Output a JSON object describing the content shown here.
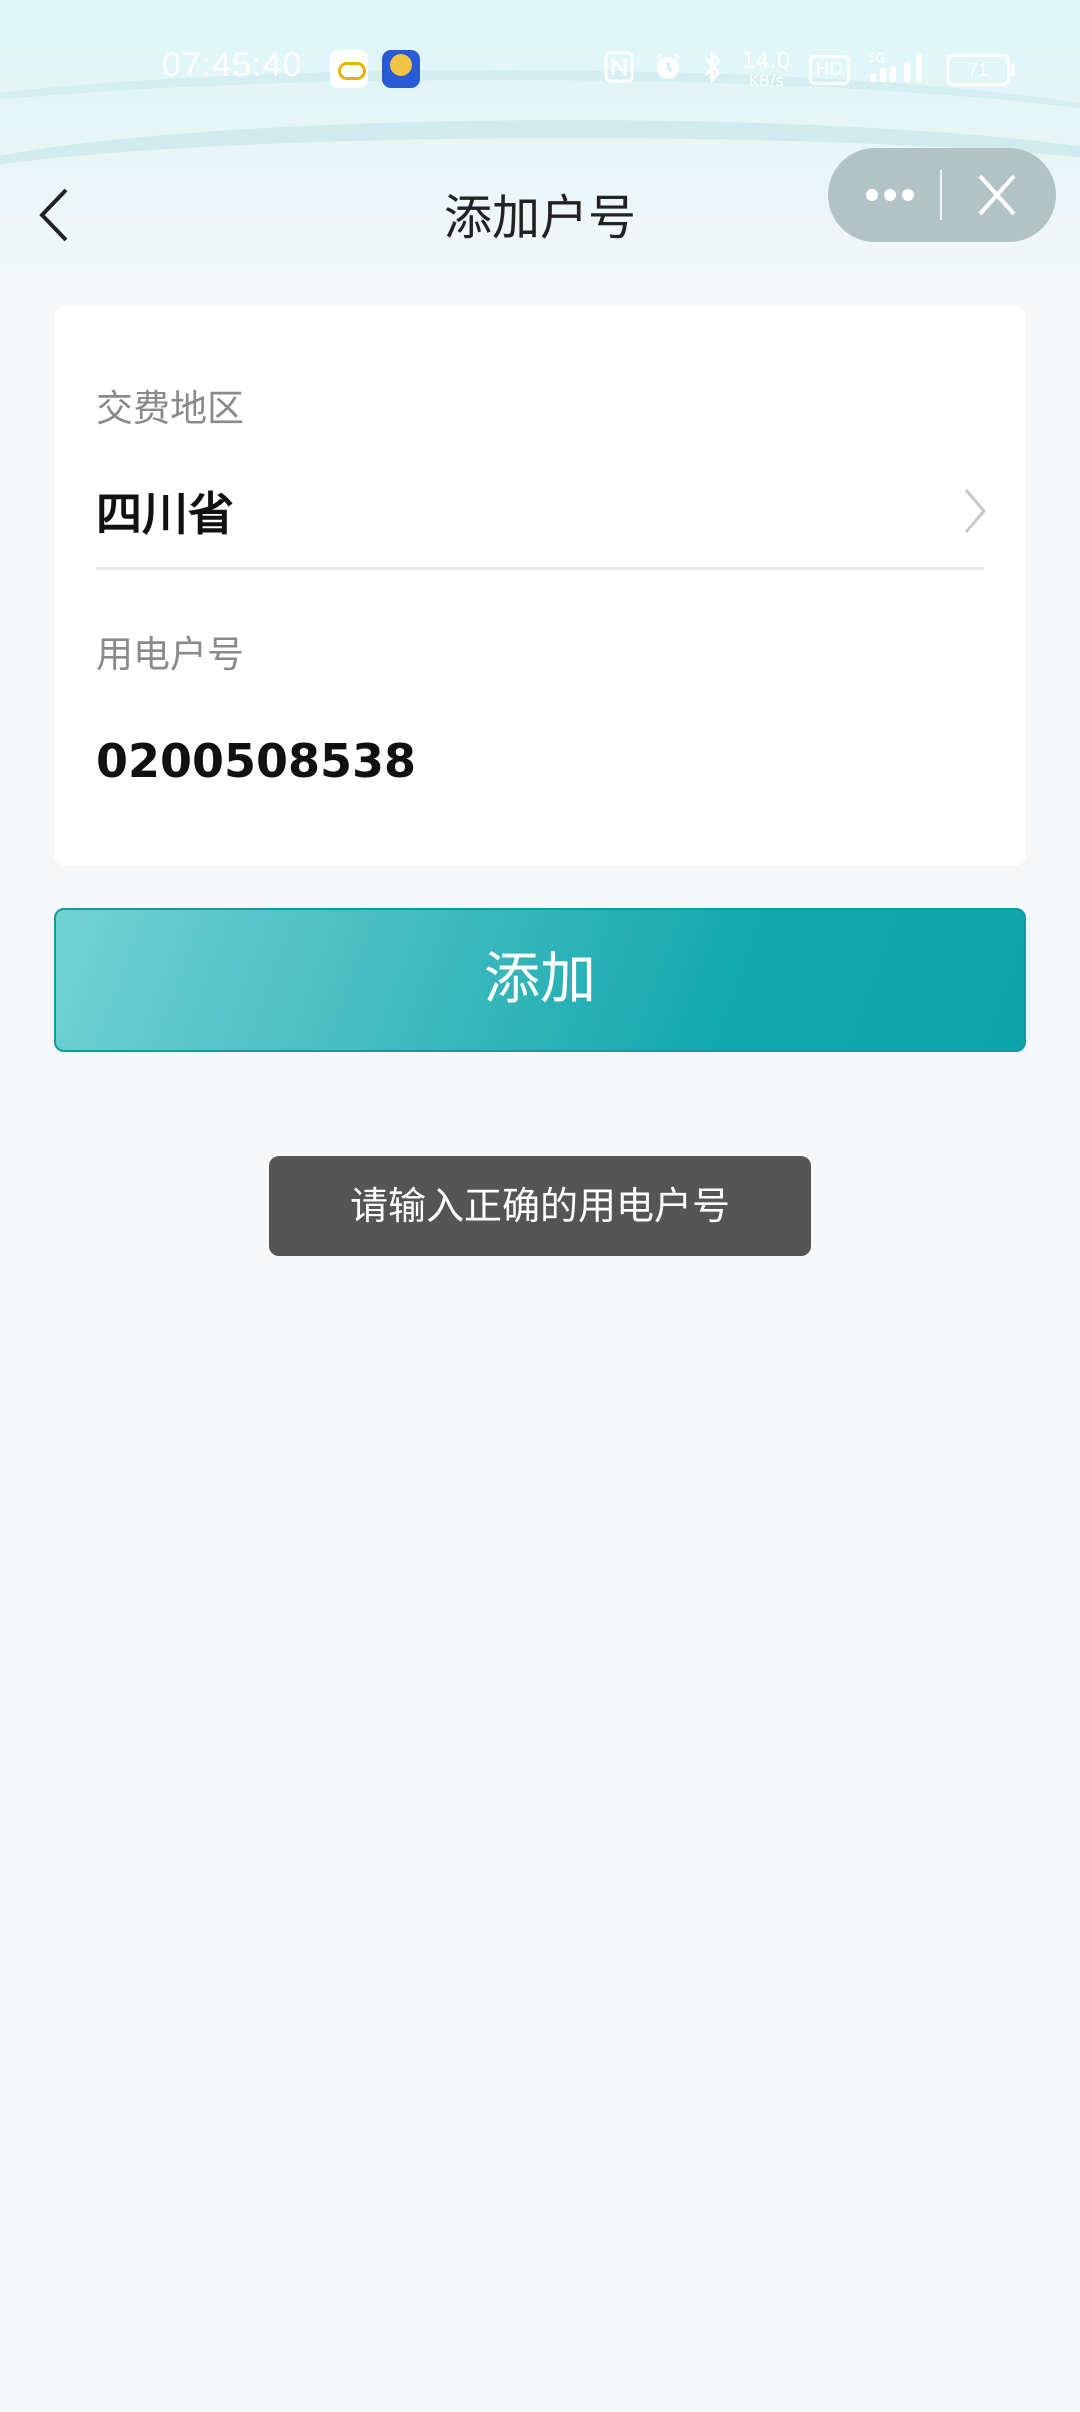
{
  "status_bar": {
    "time": "07:45:40",
    "net_speed_value": "14.0",
    "net_speed_unit": "KB/s",
    "network_type": "HD",
    "signal": "5G",
    "battery": "71",
    "icons": [
      "weather-app-icon",
      "mascot-app-icon",
      "nfc-icon",
      "alarm-icon",
      "bluetooth-icon",
      "hd-icon",
      "signal-icon",
      "battery-icon"
    ]
  },
  "nav": {
    "title": "添加户号",
    "back_icon": "chevron-left-icon",
    "more_icon": "more-dots-icon",
    "close_icon": "close-icon"
  },
  "form": {
    "region_label": "交费地区",
    "region_value": "四川省",
    "account_label": "用电户号",
    "account_value": "0200508538"
  },
  "actions": {
    "add_label": "添加"
  },
  "toast": {
    "message": "请输入正确的用电户号"
  },
  "colors": {
    "accent_start": "#72d2d2",
    "accent_end": "#0da4ab",
    "page_bg": "#f5f7f9",
    "toast_bg": "#555555"
  }
}
